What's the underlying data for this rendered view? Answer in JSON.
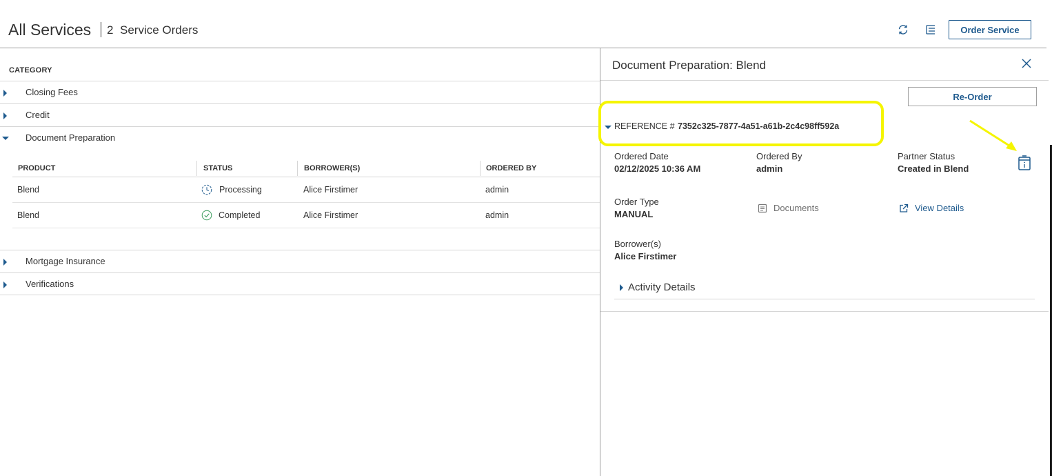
{
  "header": {
    "title": "All Services",
    "count": "2",
    "count_label": "Service Orders",
    "order_service_label": "Order Service",
    "refresh_icon": "refresh-icon",
    "list_settings_icon": "list-settings-icon"
  },
  "categories": {
    "header": "CATEGORY",
    "items": [
      {
        "label": "Closing Fees",
        "expanded": false
      },
      {
        "label": "Credit",
        "expanded": false
      },
      {
        "label": "Document Preparation",
        "expanded": true
      },
      {
        "label": "Mortgage Insurance",
        "expanded": false
      },
      {
        "label": "Verifications",
        "expanded": false
      }
    ]
  },
  "table": {
    "columns": [
      "PRODUCT",
      "STATUS",
      "BORROWER(S)",
      "ORDERED BY"
    ],
    "rows": [
      {
        "product": "Blend",
        "status": "Processing",
        "status_icon": "clock-icon",
        "borrower": "Alice Firstimer",
        "ordered_by": "admin"
      },
      {
        "product": "Blend",
        "status": "Completed",
        "status_icon": "check-circle-icon",
        "borrower": "Alice Firstimer",
        "ordered_by": "admin"
      }
    ]
  },
  "panel": {
    "title": "Document Preparation: Blend",
    "reorder_label": "Re-Order",
    "reference_label": "REFERENCE #",
    "reference_value": "7352c325-7877-4a51-a61b-2c4c98ff592a",
    "ordered_date_label": "Ordered Date",
    "ordered_date_value": "02/12/2025 10:36 AM",
    "ordered_by_label": "Ordered By",
    "ordered_by_value": "admin",
    "partner_status_label": "Partner Status",
    "partner_status_value": "Created in Blend",
    "order_type_label": "Order Type",
    "order_type_value": "MANUAL",
    "documents_label": "Documents",
    "view_details_label": "View Details",
    "borrowers_label": "Borrower(s)",
    "borrowers_value": "Alice Firstimer",
    "activity_label": "Activity Details"
  },
  "colors": {
    "accent": "#1e5a8e",
    "highlight": "#f5f500",
    "success": "#3a9b5c"
  }
}
